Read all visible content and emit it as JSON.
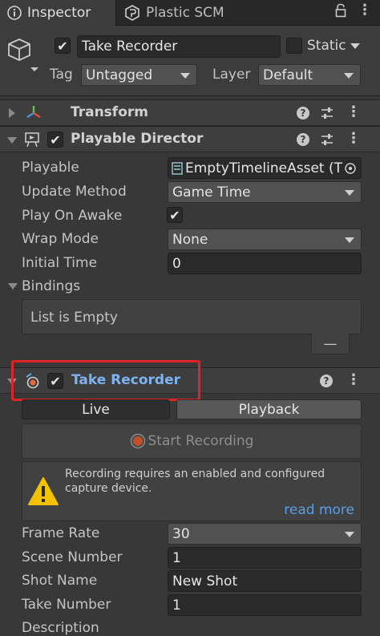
{
  "tabs": [
    {
      "label": "Inspector",
      "icon": "info-icon"
    },
    {
      "label": "Plastic SCM",
      "icon": "plastic-scm-icon"
    }
  ],
  "window_icons": [
    "lock-icon",
    "kebab-menu-icon"
  ],
  "gameobject": {
    "name": "Take Recorder",
    "static_label": "Static",
    "tag_label": "Tag",
    "tag_value": "Untagged",
    "layer_label": "Layer",
    "layer_value": "Default"
  },
  "transform": {
    "title": "Transform"
  },
  "playable_director": {
    "title": "Playable Director",
    "fields": {
      "playable_label": "Playable",
      "playable_value": "EmptyTimelineAsset (T",
      "update_method_label": "Update Method",
      "update_method_value": "Game Time",
      "play_on_awake_label": "Play On Awake",
      "wrap_mode_label": "Wrap Mode",
      "wrap_mode_value": "None",
      "initial_time_label": "Initial Time",
      "initial_time_value": "0"
    },
    "bindings_label": "Bindings",
    "bindings_empty": "List is Empty",
    "remove_button": "—"
  },
  "take_recorder": {
    "title": "Take Recorder",
    "live_label": "Live",
    "playback_label": "Playback",
    "start_recording": "Start Recording",
    "warning_text_1": "Recording requires an enabled and configured",
    "warning_text_2": "capture device.",
    "read_more": "read more",
    "fields": {
      "frame_rate_label": "Frame Rate",
      "frame_rate_value": "30",
      "scene_number_label": "Scene Number",
      "scene_number_value": "1",
      "shot_name_label": "Shot Name",
      "shot_name_value": "New Shot",
      "take_number_label": "Take Number",
      "take_number_value": "1",
      "description_label": "Description"
    }
  },
  "colors": {
    "highlight": "#e02424",
    "link": "#5a9de8",
    "warning": "#f2c200"
  }
}
